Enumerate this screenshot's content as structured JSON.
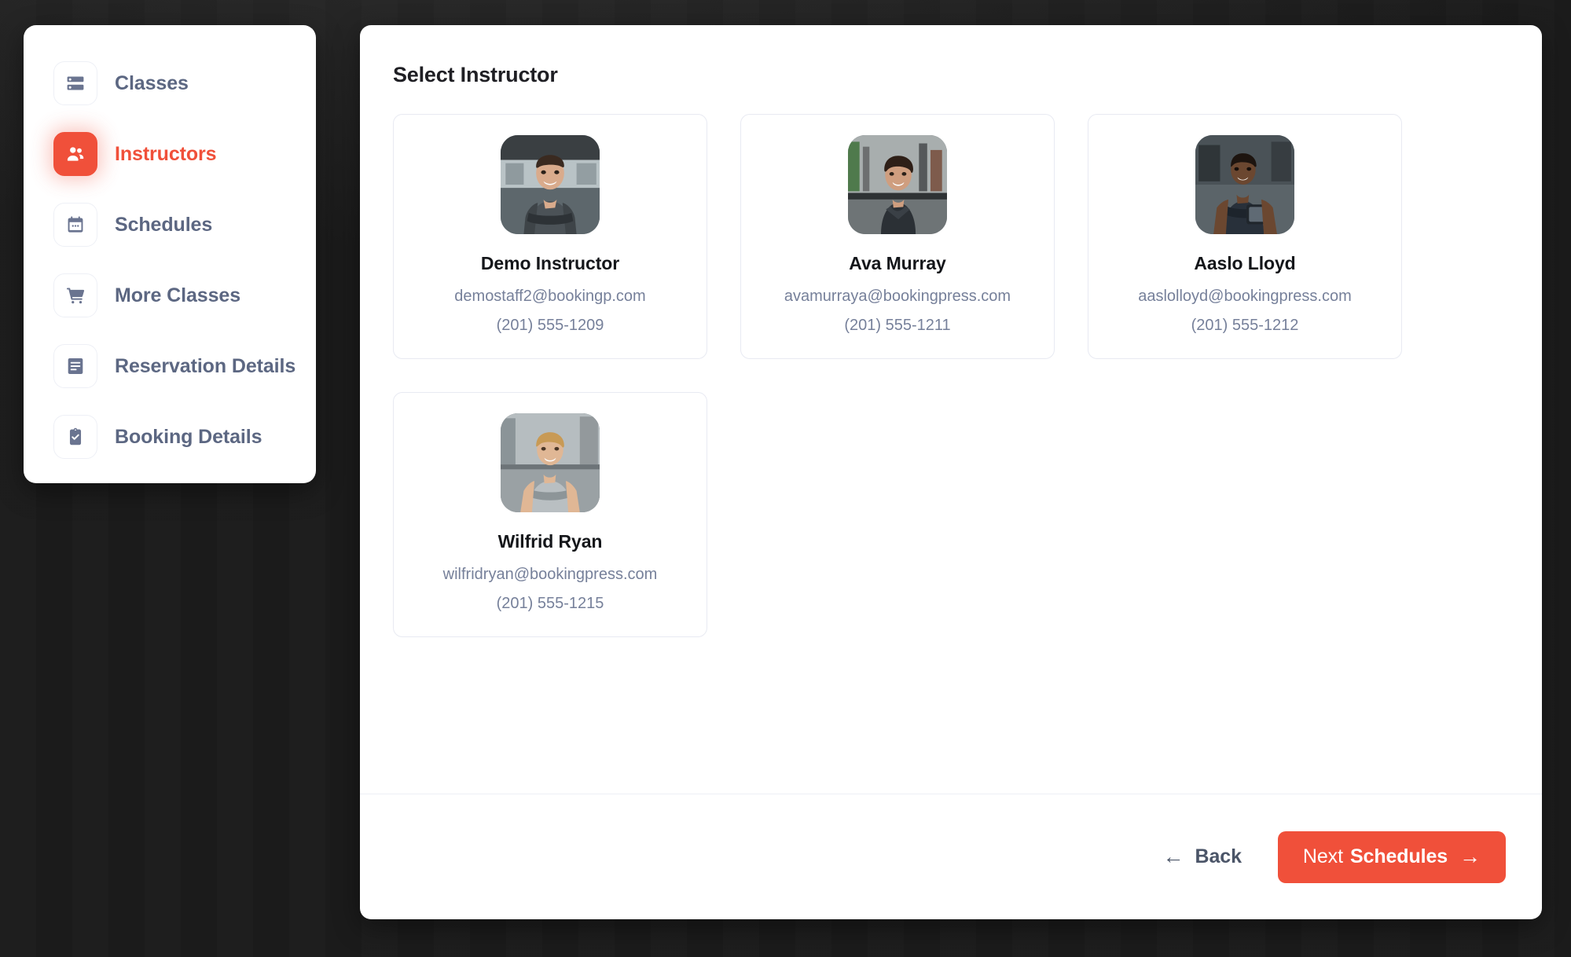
{
  "sidebar": {
    "items": [
      {
        "label": "Classes",
        "icon": "server-list-icon",
        "active": false
      },
      {
        "label": "Instructors",
        "icon": "people-group-icon",
        "active": true
      },
      {
        "label": "Schedules",
        "icon": "calendar-icon",
        "active": false
      },
      {
        "label": "More Classes",
        "icon": "shopping-cart-icon",
        "active": false
      },
      {
        "label": "Reservation Details",
        "icon": "document-icon",
        "active": false
      },
      {
        "label": "Booking Details",
        "icon": "clipboard-check-icon",
        "active": false
      }
    ]
  },
  "main": {
    "title": "Select Instructor",
    "instructors": [
      {
        "name": "Demo Instructor",
        "email": "demostaff2@bookingp.com",
        "phone": "(201) 555-1209",
        "photo": "male-instructor-arms-crossed-gym"
      },
      {
        "name": "Ava Murray",
        "email": "avamurraya@bookingpress.com",
        "phone": "(201) 555-1211",
        "photo": "female-instructor-smiling-gym"
      },
      {
        "name": "Aaslo Lloyd",
        "email": "aaslolloyd@bookingpress.com",
        "phone": "(201) 555-1212",
        "photo": "male-instructor-tablet-gym"
      },
      {
        "name": "Wilfrid Ryan",
        "email": "wilfridryan@bookingpress.com",
        "phone": "(201) 555-1215",
        "photo": "blond-male-instructor-gym"
      }
    ]
  },
  "footer": {
    "back_label": "Back",
    "back_arrow": "←",
    "next_label_light": "Next",
    "next_label_bold": "Schedules",
    "next_arrow": "→"
  },
  "colors": {
    "accent": "#f0503a",
    "text_dark": "#14161a",
    "text_muted": "#76809a",
    "sidebar_text": "#5c6782",
    "border": "#e8eaf2",
    "backdrop": "#1a1a1a",
    "panel": "#ffffff"
  }
}
